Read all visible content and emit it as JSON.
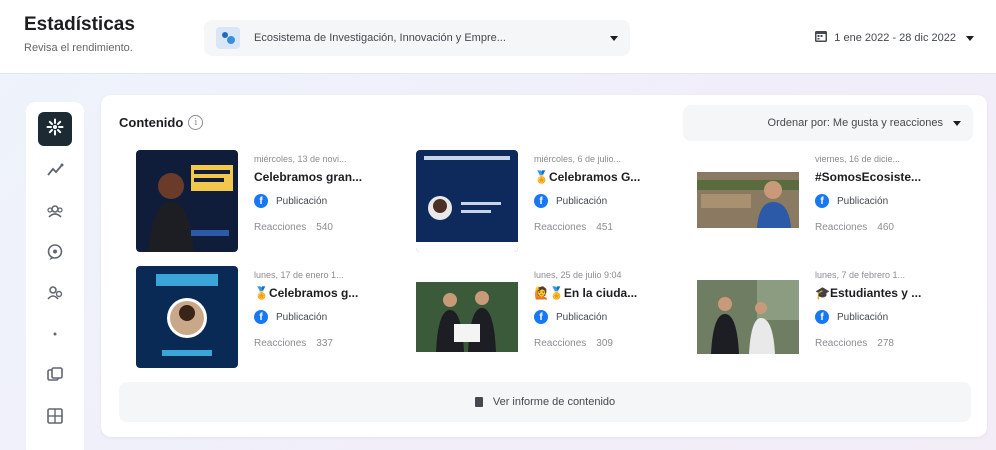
{
  "header": {
    "title": "Estadísticas",
    "subtitle": "Revisa el rendimiento.",
    "account_name": "Ecosistema de Investigación, Innovación y Empre...",
    "date_range": "1 ene 2022 - 28 dic 2022"
  },
  "content": {
    "title": "Contenido",
    "sort_label": "Ordenar por: Me gusta y reacciones",
    "report_label": "Ver informe de contenido",
    "reactions_label": "Reacciones",
    "posts": [
      {
        "date": "miércoles, 13 de novi...",
        "title": "Celebramos gran...",
        "type": "Publicación",
        "reactions": "540"
      },
      {
        "date": "miércoles, 6 de julio...",
        "title": "🏅Celebramos G...",
        "type": "Publicación",
        "reactions": "451"
      },
      {
        "date": "viernes, 16 de dicie...",
        "title": "#SomosEcosiste...",
        "type": "Publicación",
        "reactions": "460"
      },
      {
        "date": "lunes, 17 de enero 1...",
        "title": "🏅Celebramos g...",
        "type": "Publicación",
        "reactions": "337"
      },
      {
        "date": "lunes, 25 de julio 9:04",
        "title": "🙋🏅En la ciuda...",
        "type": "Publicación",
        "reactions": "309"
      },
      {
        "date": "lunes, 7 de febrero 1...",
        "title": "🎓Estudiantes y ...",
        "type": "Publicación",
        "reactions": "278"
      }
    ]
  },
  "sidebar": {
    "items": [
      "overview-icon",
      "trend-icon",
      "audience-icon",
      "messages-icon",
      "people-icon",
      "dot-icon",
      "content-icon",
      "grid-icon"
    ]
  },
  "colors": {
    "accent": "#1877f2",
    "active_sidebar": "#1c2b33"
  }
}
